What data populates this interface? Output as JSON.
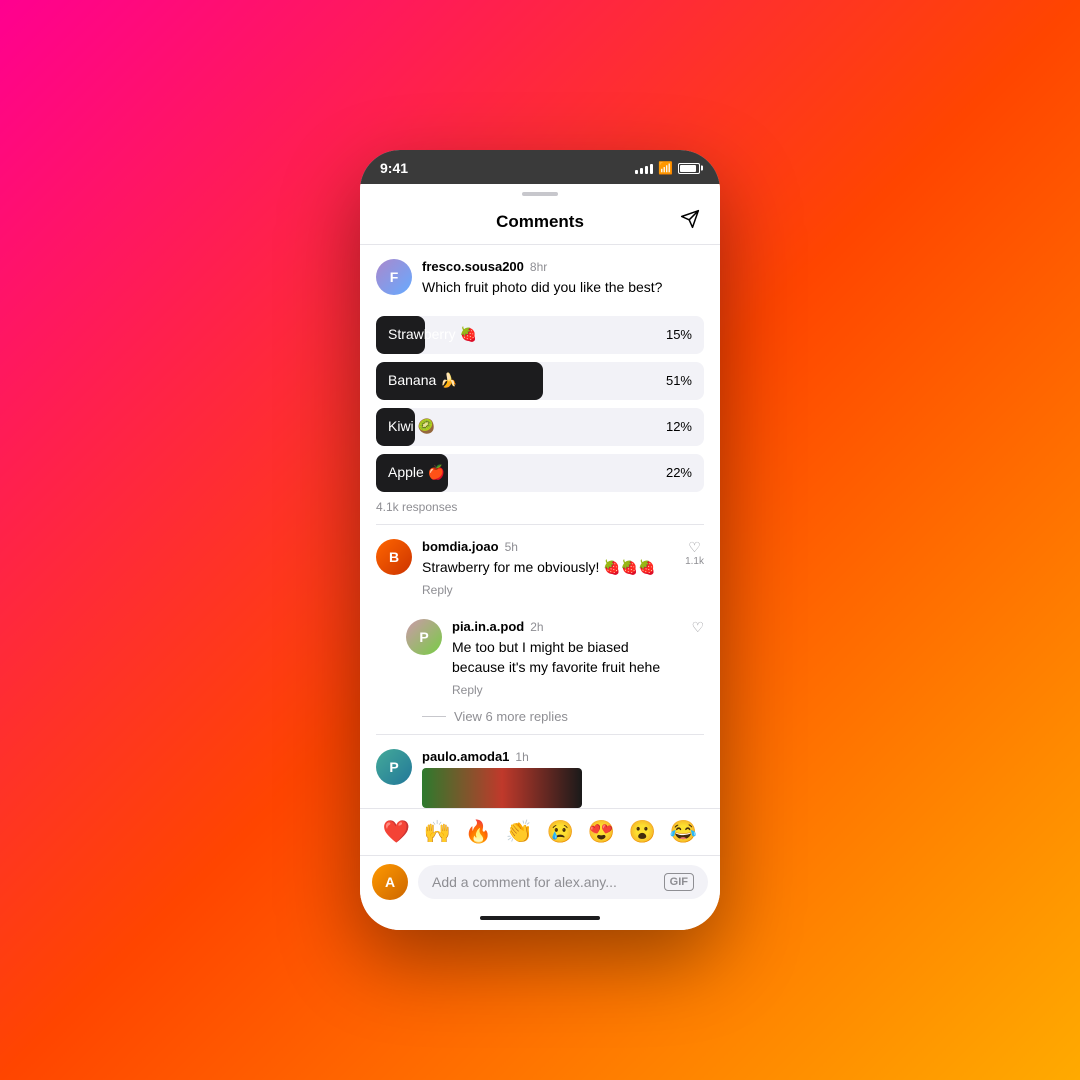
{
  "status_bar": {
    "time": "9:41",
    "battery_visible": true
  },
  "header": {
    "title": "Comments",
    "send_icon": "▷"
  },
  "post_comment": {
    "username": "fresco.sousa200",
    "time": "8hr",
    "text": "Which fruit photo did you like the best?",
    "poll": {
      "options": [
        {
          "label": "Strawberry 🍓",
          "pct": "15%",
          "pct_num": 15,
          "is_winner": false
        },
        {
          "label": "Banana 🍌",
          "pct": "51%",
          "pct_num": 51,
          "is_winner": true
        },
        {
          "label": "Kiwi 🥝",
          "pct": "12%",
          "pct_num": 12,
          "is_winner": false
        },
        {
          "label": "Apple 🍎",
          "pct": "22%",
          "pct_num": 22,
          "is_winner": false
        }
      ],
      "responses": "4.1k responses"
    }
  },
  "comments": [
    {
      "username": "bomdia.joao",
      "time": "5h",
      "text": "Strawberry for me obviously! 🍓🍓🍓",
      "likes": "1.1k",
      "replies": [
        {
          "username": "pia.in.a.pod",
          "time": "2h",
          "text": "Me too but I might be biased because it's my favorite fruit hehe",
          "likes": ""
        }
      ],
      "view_more_replies": "View 6 more replies"
    },
    {
      "username": "paulo.amoda1",
      "time": "1h",
      "text": "",
      "likes": ""
    }
  ],
  "emoji_bar": [
    "❤️",
    "🙌",
    "🔥",
    "👏",
    "😢",
    "😍",
    "😮",
    "😂"
  ],
  "comment_input": {
    "placeholder": "Add a comment for alex.any...",
    "gif_label": "GIF"
  }
}
